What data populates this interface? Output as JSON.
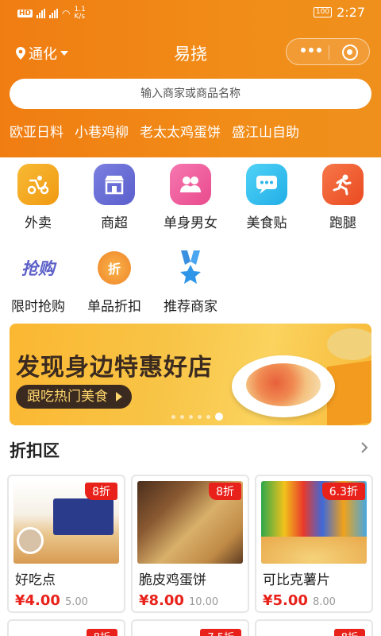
{
  "status": {
    "hd": "HD",
    "net_speed": "1.1\nK/s",
    "battery": "100",
    "time": "2:27"
  },
  "nav": {
    "location": "通化",
    "title": "易挠"
  },
  "search": {
    "placeholder": "输入商家或商品名称"
  },
  "hot_tags": [
    "欧亚日料",
    "小巷鸡柳",
    "老太太鸡蛋饼",
    "盛江山自助"
  ],
  "categories_row1": [
    {
      "label": "外卖",
      "icon": "delivery-icon",
      "color": "#f5a51b"
    },
    {
      "label": "商超",
      "icon": "store-icon",
      "color": "#6a6fd8"
    },
    {
      "label": "单身男女",
      "icon": "couple-icon",
      "color": "#f15fa0"
    },
    {
      "label": "美食贴",
      "icon": "chat-icon",
      "color": "#2ec0f0"
    },
    {
      "label": "跑腿",
      "icon": "runner-icon",
      "color": "#f2592c"
    }
  ],
  "categories_row2": [
    {
      "label": "限时抢购",
      "icon": "flash-sale-icon",
      "text": "抢购"
    },
    {
      "label": "单品折扣",
      "icon": "discount-icon",
      "text": "折"
    },
    {
      "label": "推荐商家",
      "icon": "recommend-medal-icon"
    }
  ],
  "banner": {
    "headline": "发现身边特惠好店",
    "sub": "跟吃热门美食"
  },
  "discount_section": {
    "title": "折扣区"
  },
  "products": [
    {
      "name": "好吃点",
      "price": "¥4.00",
      "orig": "5.00",
      "badge": "8折"
    },
    {
      "name": "脆皮鸡蛋饼",
      "price": "¥8.00",
      "orig": "10.00",
      "badge": "8折"
    },
    {
      "name": "可比克薯片",
      "price": "¥5.00",
      "orig": "8.00",
      "badge": "6.3折"
    }
  ],
  "products_next_badges": [
    "8折",
    "7.5折",
    "8折"
  ]
}
